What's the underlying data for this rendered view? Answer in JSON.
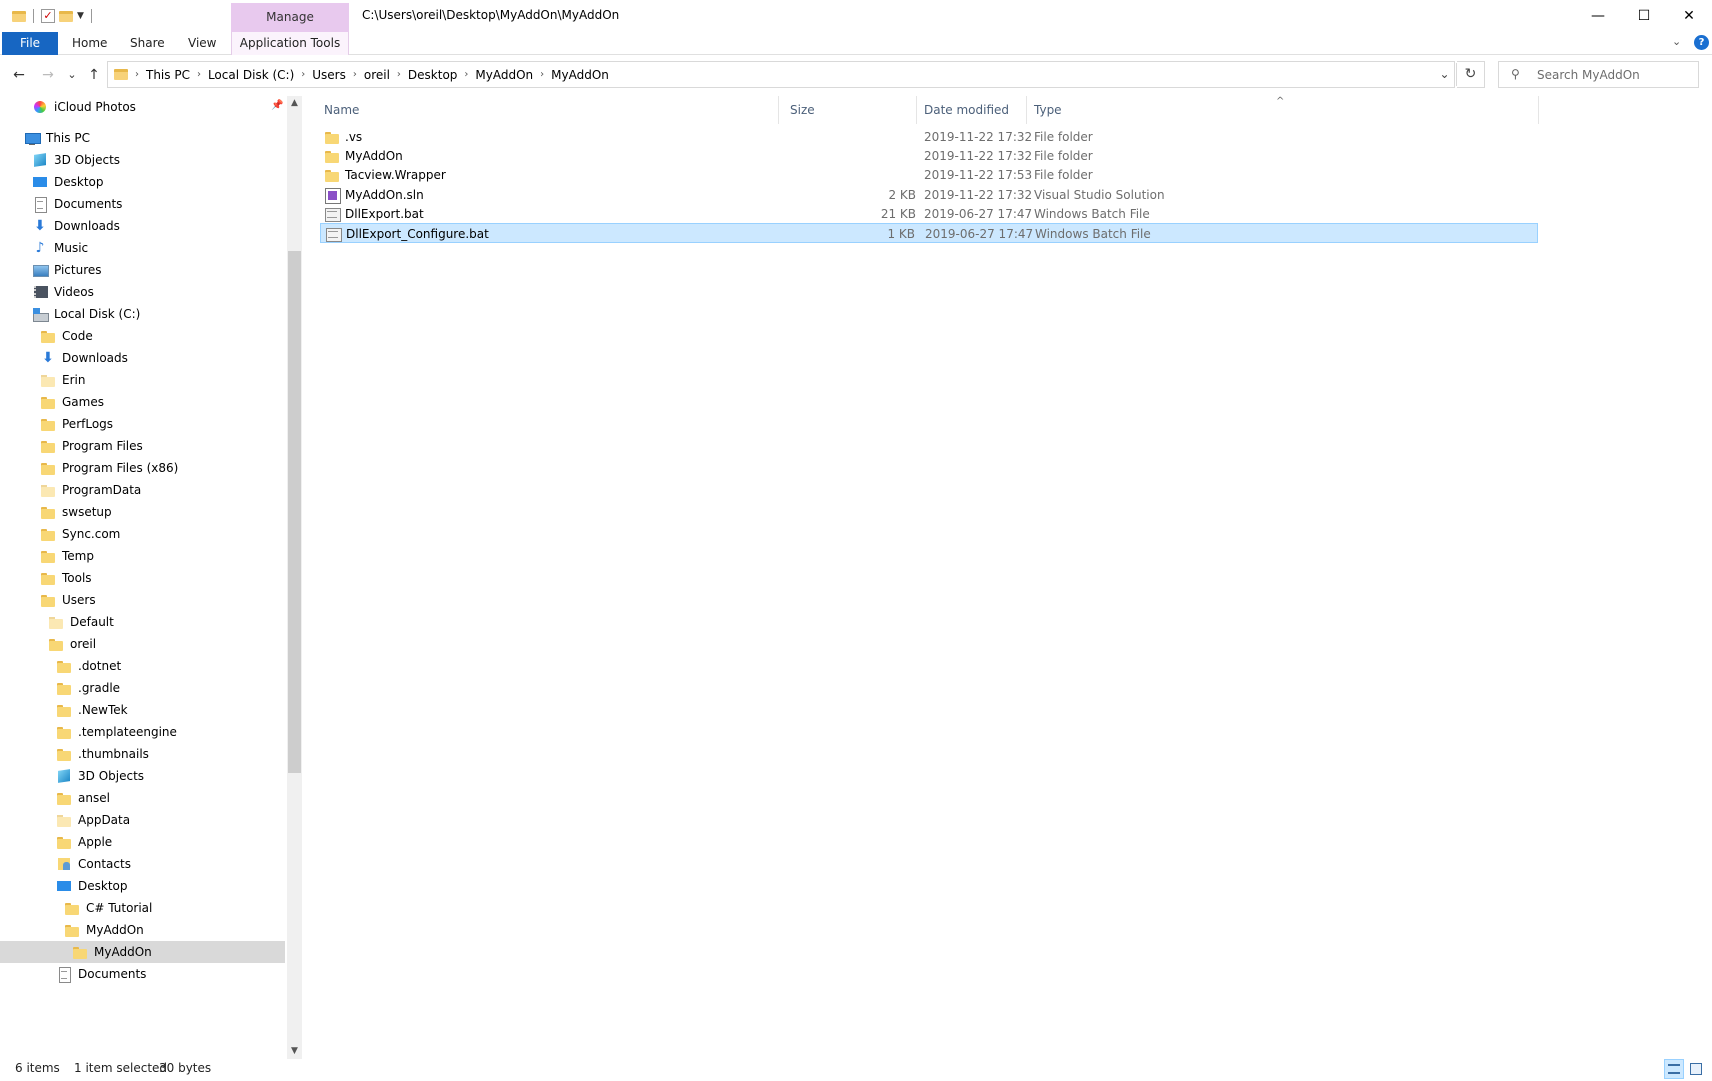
{
  "window": {
    "title_path": "C:\\Users\\oreil\\Desktop\\MyAddOn\\MyAddOn",
    "manage_label": "Manage",
    "minimize": "—",
    "maximize": "☐",
    "close": "✕"
  },
  "ribbon": {
    "tabs": [
      {
        "label": "File"
      },
      {
        "label": "Home"
      },
      {
        "label": "Share"
      },
      {
        "label": "View"
      },
      {
        "label": "Application Tools"
      }
    ],
    "expand_glyph": "⌄",
    "help_glyph": "?"
  },
  "nav": {
    "back": "←",
    "forward": "→",
    "recent": "⌄",
    "up": "↑",
    "breadcrumbs": [
      "This PC",
      "Local Disk (C:)",
      "Users",
      "oreil",
      "Desktop",
      "MyAddOn",
      "MyAddOn"
    ],
    "chevron": "›",
    "dropdown": "⌄",
    "refresh": "↻",
    "search_placeholder": "Search MyAddOn",
    "search_glyph": "⚲"
  },
  "tree": [
    {
      "label": "iCloud Photos",
      "icon": "icloud"
    },
    {
      "label": "This PC",
      "icon": "pc"
    },
    {
      "label": "3D Objects",
      "icon": "cube"
    },
    {
      "label": "Desktop",
      "icon": "desktop"
    },
    {
      "label": "Documents",
      "icon": "doc"
    },
    {
      "label": "Downloads",
      "icon": "download"
    },
    {
      "label": "Music",
      "icon": "music"
    },
    {
      "label": "Pictures",
      "icon": "pictures"
    },
    {
      "label": "Videos",
      "icon": "videos"
    },
    {
      "label": "Local Disk (C:)",
      "icon": "disk"
    },
    {
      "label": "Code",
      "icon": "folder"
    },
    {
      "label": "Downloads",
      "icon": "download"
    },
    {
      "label": "Erin",
      "icon": "folder-pale"
    },
    {
      "label": "Games",
      "icon": "folder"
    },
    {
      "label": "PerfLogs",
      "icon": "folder"
    },
    {
      "label": "Program Files",
      "icon": "folder"
    },
    {
      "label": "Program Files (x86)",
      "icon": "folder"
    },
    {
      "label": "ProgramData",
      "icon": "folder-pale"
    },
    {
      "label": "swsetup",
      "icon": "folder"
    },
    {
      "label": "Sync.com",
      "icon": "folder"
    },
    {
      "label": "Temp",
      "icon": "folder"
    },
    {
      "label": "Tools",
      "icon": "folder"
    },
    {
      "label": "Users",
      "icon": "folder"
    },
    {
      "label": "Default",
      "icon": "folder-pale"
    },
    {
      "label": "oreil",
      "icon": "folder"
    },
    {
      "label": ".dotnet",
      "icon": "folder"
    },
    {
      "label": ".gradle",
      "icon": "folder"
    },
    {
      "label": ".NewTek",
      "icon": "folder"
    },
    {
      "label": ".templateengine",
      "icon": "folder"
    },
    {
      "label": ".thumbnails",
      "icon": "folder"
    },
    {
      "label": "3D Objects",
      "icon": "cube"
    },
    {
      "label": "ansel",
      "icon": "folder"
    },
    {
      "label": "AppData",
      "icon": "folder-pale"
    },
    {
      "label": "Apple",
      "icon": "folder"
    },
    {
      "label": "Contacts",
      "icon": "contacts"
    },
    {
      "label": "Desktop",
      "icon": "desktop"
    },
    {
      "label": "C# Tutorial",
      "icon": "folder"
    },
    {
      "label": "MyAddOn",
      "icon": "folder"
    },
    {
      "label": "MyAddOn",
      "icon": "folder",
      "selected": true
    },
    {
      "label": "Documents",
      "icon": "doc"
    }
  ],
  "columns": {
    "name": "Name",
    "size": "Size",
    "date": "Date modified",
    "type": "Type",
    "sort_glyph": "^"
  },
  "files": [
    {
      "name": ".vs",
      "size": "",
      "date": "2019-11-22 17:32",
      "type": "File folder",
      "icon": "folder"
    },
    {
      "name": "MyAddOn",
      "size": "",
      "date": "2019-11-22 17:32",
      "type": "File folder",
      "icon": "folder"
    },
    {
      "name": "Tacview.Wrapper",
      "size": "",
      "date": "2019-11-22 17:53",
      "type": "File folder",
      "icon": "folder"
    },
    {
      "name": "MyAddOn.sln",
      "size": "2 KB",
      "date": "2019-11-22 17:32",
      "type": "Visual Studio Solution",
      "icon": "sln"
    },
    {
      "name": "DllExport.bat",
      "size": "21 KB",
      "date": "2019-06-27 17:47",
      "type": "Windows Batch File",
      "icon": "bat"
    },
    {
      "name": "DllExport_Configure.bat",
      "size": "1 KB",
      "date": "2019-06-27 17:47",
      "type": "Windows Batch File",
      "icon": "bat",
      "selected": true
    }
  ],
  "status": {
    "items": "6 items",
    "selected": "1 item selected",
    "bytes": "30 bytes"
  }
}
